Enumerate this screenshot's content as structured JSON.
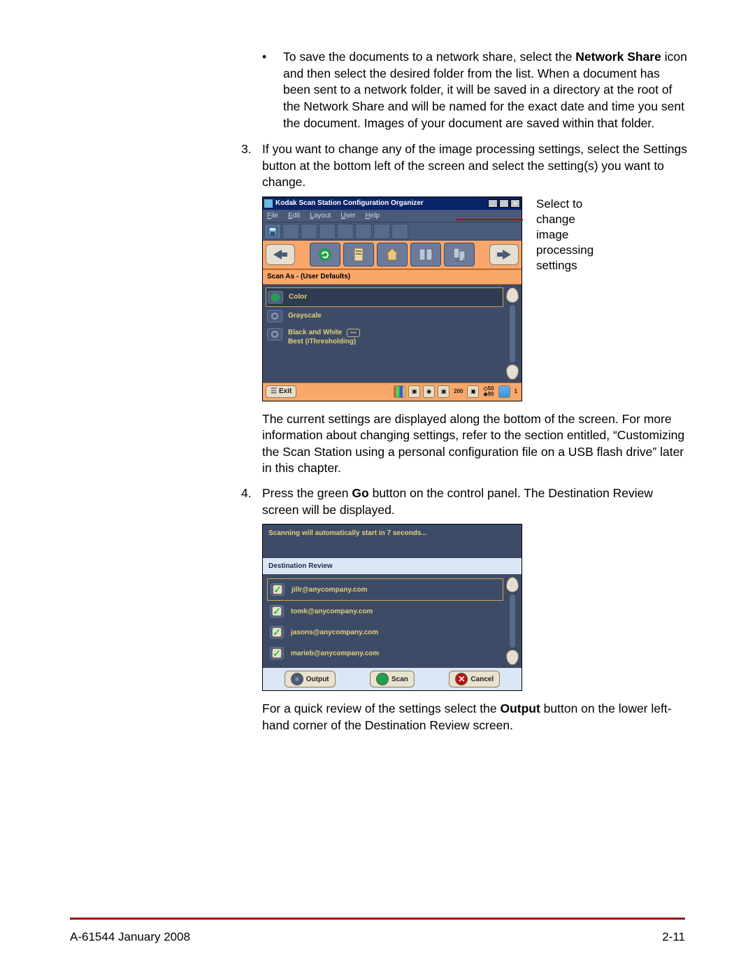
{
  "body": {
    "bullet1_prefix": "To save the documents to a network share, select the ",
    "bullet1_bold1": "Network Share",
    "bullet1_rest": " icon and then select the desired folder from the list. When a document has been sent to a network folder, it will be saved in a directory at the root of the Network Share and will be named for the exact date and time you sent the document. Images of your document are saved within that folder.",
    "step3_num": "3.",
    "step3_text": "If you want to change any of the image processing settings, select the Settings button at the bottom left of the screen and select the setting(s) you want to change.",
    "callout": "Select to change image processing settings",
    "para_after_shot1": "The current settings are displayed along the bottom of the screen. For more information about changing settings, refer to the section entitled, “Customizing the Scan Station using a personal configuration file on a USB flash drive” later in this chapter.",
    "step4_num": "4.",
    "step4_prefix": "Press the green ",
    "step4_bold": "Go",
    "step4_rest": " button on the control panel. The Destination Review screen will be displayed.",
    "para_after_shot2_prefix": "For a quick review of the settings select the ",
    "para_after_shot2_bold": "Output",
    "para_after_shot2_rest": " button on the lower left-hand corner of the Destination Review screen."
  },
  "shot1": {
    "title": "Kodak Scan Station Configuration Organizer",
    "menu": {
      "file": "File",
      "edit": "Edit",
      "layout": "Layout",
      "user": "User",
      "help": "Help"
    },
    "section": "Scan As - (User Defaults)",
    "rows": {
      "color": "Color",
      "grayscale": "Grayscale",
      "bw": "Black and White",
      "bw_sub": "Best (iThresholding)"
    },
    "exit": "Exit",
    "bottom": {
      "v200": "200",
      "v50": "50",
      "v90": "90",
      "v1": "1"
    }
  },
  "shot2": {
    "msg": "Scanning will automatically start in 7 seconds...",
    "hdr": "Destination Review",
    "rows": {
      "r1": "jillr@anycompany.com",
      "r2": "tomk@anycompany.com",
      "r3": "jasons@anycompany.com",
      "r4": "marieb@anycompany.com"
    },
    "buttons": {
      "output": "Output",
      "scan": "Scan",
      "cancel": "Cancel"
    }
  },
  "footer": {
    "left": "A-61544  January 2008",
    "right": "2-11"
  }
}
